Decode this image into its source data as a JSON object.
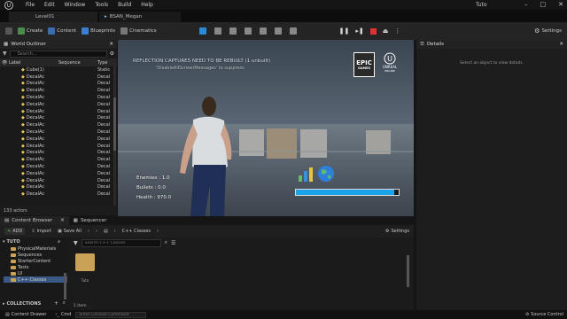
{
  "menubar": {
    "items": [
      "File",
      "Edit",
      "Window",
      "Tools",
      "Build",
      "Help"
    ],
    "project": "Tuto"
  },
  "tabs": [
    {
      "label": "Level01"
    },
    {
      "label": "BSAN_Megan"
    }
  ],
  "toolbar": {
    "create": "Create",
    "content": "Content",
    "blueprints": "Blueprints",
    "cinematics": "Cinematics",
    "settings": "Settings"
  },
  "outliner": {
    "title": "World Outliner",
    "search_placeholder": "Search...",
    "columns": [
      "Label",
      "Sequence",
      "Type"
    ],
    "rows": [
      {
        "label": "Cube(1)",
        "type": "Static"
      },
      {
        "label": "DecalAc",
        "type": "Decal"
      },
      {
        "label": "DecalAc",
        "type": "Decal"
      },
      {
        "label": "DecalAc",
        "type": "Decal"
      },
      {
        "label": "DecalAc",
        "type": "Decal"
      },
      {
        "label": "DecalAc",
        "type": "Decal"
      },
      {
        "label": "DecalAc",
        "type": "Decal"
      },
      {
        "label": "DecalAc",
        "type": "Decal"
      },
      {
        "label": "DecalAc",
        "type": "Decal"
      },
      {
        "label": "DecalAc",
        "type": "Decal"
      },
      {
        "label": "DecalAc",
        "type": "Decal"
      },
      {
        "label": "DecalAc",
        "type": "Decal"
      },
      {
        "label": "DecalAc",
        "type": "Decal"
      },
      {
        "label": "DecalAc",
        "type": "Decal"
      },
      {
        "label": "DecalAc",
        "type": "Decal"
      },
      {
        "label": "DecalAc",
        "type": "Decal"
      },
      {
        "label": "DecalAc",
        "type": "Decal"
      },
      {
        "label": "DecalAc",
        "type": "Decal"
      },
      {
        "label": "DecalAc",
        "type": "Decal"
      }
    ],
    "count": "133 actors"
  },
  "viewport": {
    "warning1": "REFLECTION CAPTURES NEED TO BE REBUILT (1 unbuilt)",
    "warning2": "'DisableAllScreenMessages' to suppress",
    "epic": "EPIC",
    "games": "GAMES",
    "unreal": "UNREAL",
    "unreal_sub": "ENGINE",
    "enemies": "Enemies : 1.0",
    "bullets": "Bullets : 0.0",
    "health": "Health : 970.0",
    "health_fraction": 0.96
  },
  "details": {
    "title": "Details",
    "empty": "Select an object to view details."
  },
  "content_browser": {
    "tab1": "Content Browser",
    "tab2": "Sequencer",
    "add": "ADD",
    "import": "Import",
    "saveall": "Save All",
    "path_root": "C++ Classes",
    "settings": "Settings",
    "search_placeholder": "Search C++ Classes",
    "tree_root": "TUTO",
    "folders": [
      "PhysicalMaterials",
      "Sequences",
      "StarterContent",
      "Tests",
      "UI",
      "C++ Classes"
    ],
    "asset": "Tuto",
    "collections": "COLLECTIONS",
    "items": "1 item"
  },
  "status": {
    "drawer": "Content Drawer",
    "cmd": "Cmd",
    "console_placeholder": "Enter Console Command",
    "source": "Source Control"
  }
}
